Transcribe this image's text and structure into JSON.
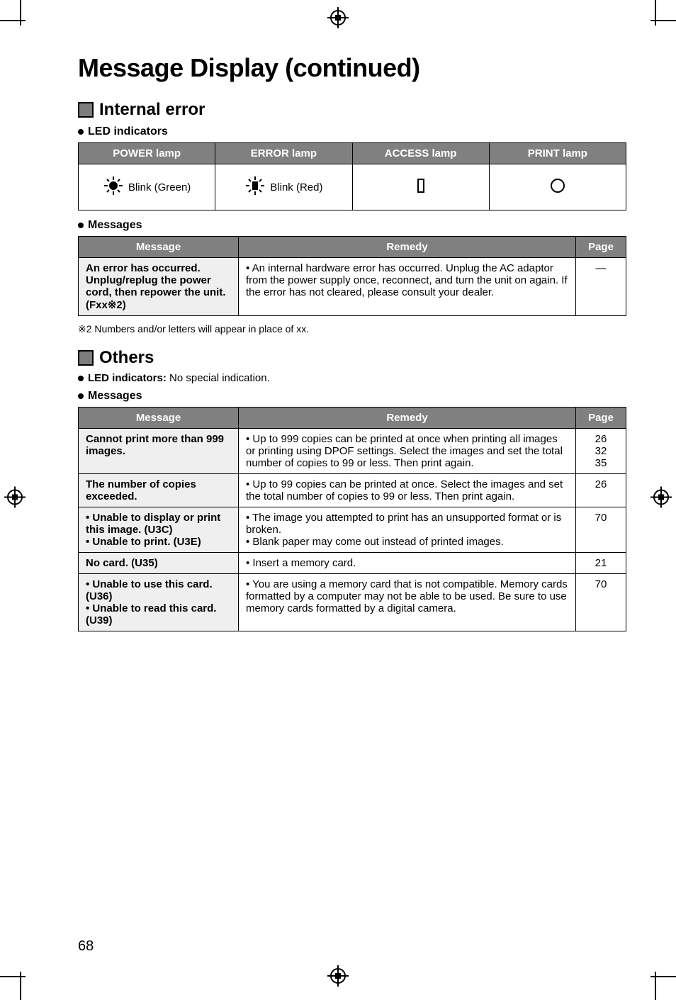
{
  "page_title": "Message Display (continued)",
  "section_internal": {
    "heading": "Internal error",
    "led_label": "LED indicators",
    "lamp_headers": [
      "POWER lamp",
      "ERROR lamp",
      "ACCESS lamp",
      "PRINT lamp"
    ],
    "lamp_row": {
      "power": "Blink (Green)",
      "error": "Blink (Red)"
    },
    "messages_label": "Messages",
    "msg_headers": [
      "Message",
      "Remedy",
      "Page"
    ],
    "rows": [
      {
        "message": "An error has occurred. Unplug/replug the power cord, then repower the unit. (Fxx※2)",
        "remedy": "• An internal hardware error has occurred. Unplug the AC adaptor from the power supply once, reconnect, and turn the unit on again. If the error has not cleared, please consult your dealer.",
        "page": "—"
      }
    ],
    "footnote": "※2 Numbers and/or letters will appear in place of xx."
  },
  "section_others": {
    "heading": "Others",
    "led_note_label": "LED indicators:",
    "led_note_text": " No special indication.",
    "messages_label": "Messages",
    "msg_headers": [
      "Message",
      "Remedy",
      "Page"
    ],
    "rows": [
      {
        "message": "Cannot print more than 999 images.",
        "remedy": "• Up to 999 copies can be printed at once when printing all images or printing using DPOF settings. Select the images and set the total number of copies to 99 or less. Then print again.",
        "page": "26\n32\n35"
      },
      {
        "message": "The number of copies exceeded.",
        "remedy": "• Up to 99 copies can be printed at once. Select the images and set the total number of copies to 99 or less. Then print again.",
        "page": "26"
      },
      {
        "message": "• Unable to display or print this image. (U3C)\n• Unable to print. (U3E)",
        "remedy": "• The image you attempted to print has an unsupported format or is broken.\n• Blank paper may come out instead of printed images.",
        "page": "70"
      },
      {
        "message": "No card. (U35)",
        "remedy": "• Insert a memory card.",
        "page": "21"
      },
      {
        "message": "• Unable to use this card. (U36)\n• Unable to read this card. (U39)",
        "remedy": "• You are using a memory card that is not compatible. Memory cards formatted by a computer may not be able to be used. Be sure to use memory cards formatted by a digital camera.",
        "page": "70"
      }
    ]
  },
  "page_number": "68"
}
